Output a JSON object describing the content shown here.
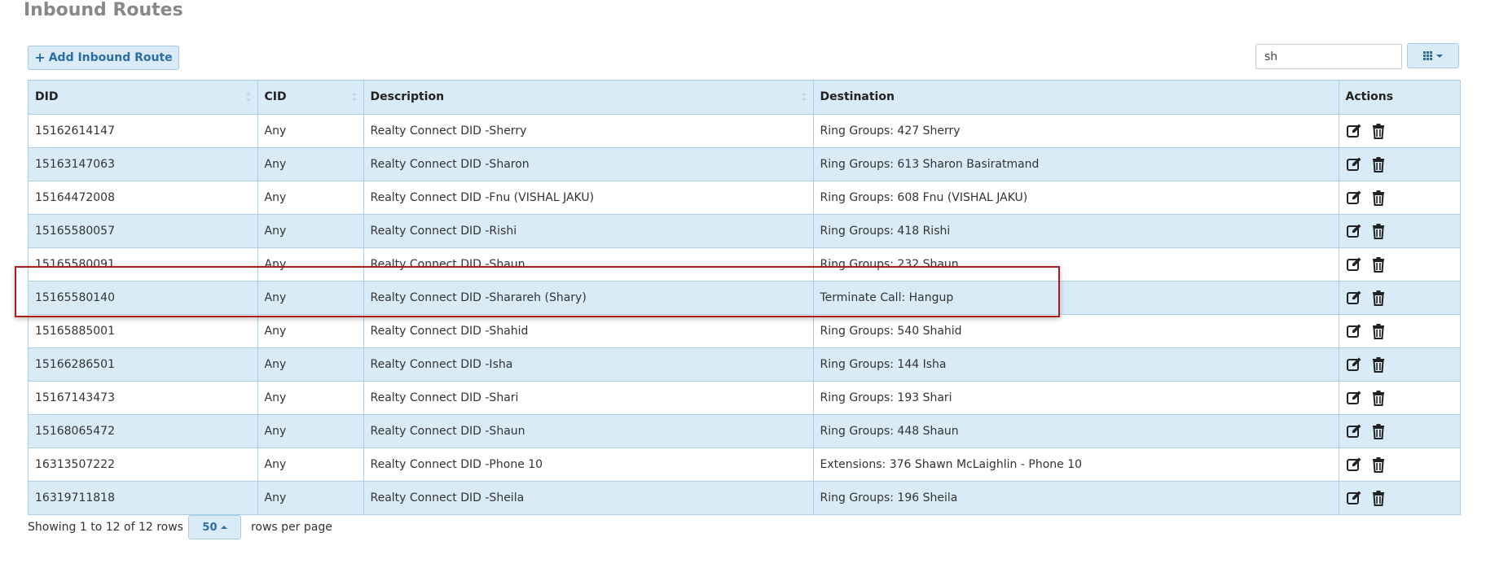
{
  "page": {
    "title": "Inbound Routes"
  },
  "toolbar": {
    "add_label": "Add Inbound Route",
    "search_value": "sh"
  },
  "table": {
    "headers": {
      "did": "DID",
      "cid": "CID",
      "description": "Description",
      "destination": "Destination",
      "actions": "Actions"
    },
    "rows": [
      {
        "did": "15162614147",
        "cid": "Any",
        "description": "Realty Connect DID -Sherry",
        "destination": "Ring Groups: 427 Sherry"
      },
      {
        "did": "15163147063",
        "cid": "Any",
        "description": "Realty Connect DID -Sharon",
        "destination": "Ring Groups: 613 Sharon Basiratmand"
      },
      {
        "did": "15164472008",
        "cid": "Any",
        "description": "Realty Connect DID -Fnu (VISHAL JAKU)",
        "destination": "Ring Groups: 608 Fnu (VISHAL JAKU)"
      },
      {
        "did": "15165580057",
        "cid": "Any",
        "description": "Realty Connect DID -Rishi",
        "destination": "Ring Groups: 418 Rishi"
      },
      {
        "did": "15165580091",
        "cid": "Any",
        "description": "Realty Connect DID -Shaun",
        "destination": "Ring Groups: 232 Shaun"
      },
      {
        "did": "15165580140",
        "cid": "Any",
        "description": "Realty Connect DID -Sharareh (Shary)",
        "destination": "Terminate Call: Hangup"
      },
      {
        "did": "15165885001",
        "cid": "Any",
        "description": "Realty Connect DID -Shahid",
        "destination": "Ring Groups: 540 Shahid"
      },
      {
        "did": "15166286501",
        "cid": "Any",
        "description": "Realty Connect DID -Isha",
        "destination": "Ring Groups: 144 Isha"
      },
      {
        "did": "15167143473",
        "cid": "Any",
        "description": "Realty Connect DID -Shari",
        "destination": "Ring Groups: 193 Shari"
      },
      {
        "did": "15168065472",
        "cid": "Any",
        "description": "Realty Connect DID -Shaun",
        "destination": "Ring Groups: 448 Shaun"
      },
      {
        "did": "16313507222",
        "cid": "Any",
        "description": "Realty Connect DID -Phone 10",
        "destination": "Extensions: 376 Shawn McLaighlin - Phone 10"
      },
      {
        "did": "16319711818",
        "cid": "Any",
        "description": "Realty Connect DID -Sheila",
        "destination": "Ring Groups: 196 Sheila"
      }
    ]
  },
  "footer": {
    "showing_text": "Showing 1 to 12 of 12 rows",
    "page_size": "50",
    "rows_per_page_label": "rows per page"
  },
  "icons": {
    "add": "plus-icon",
    "columns": "grid-icon",
    "edit": "edit-icon",
    "delete": "trash-icon"
  },
  "colors": {
    "accent": "#2d6da3",
    "row_alt": "#d9ebf7",
    "border": "#a9cfe9",
    "highlight": "#b01b1b"
  }
}
